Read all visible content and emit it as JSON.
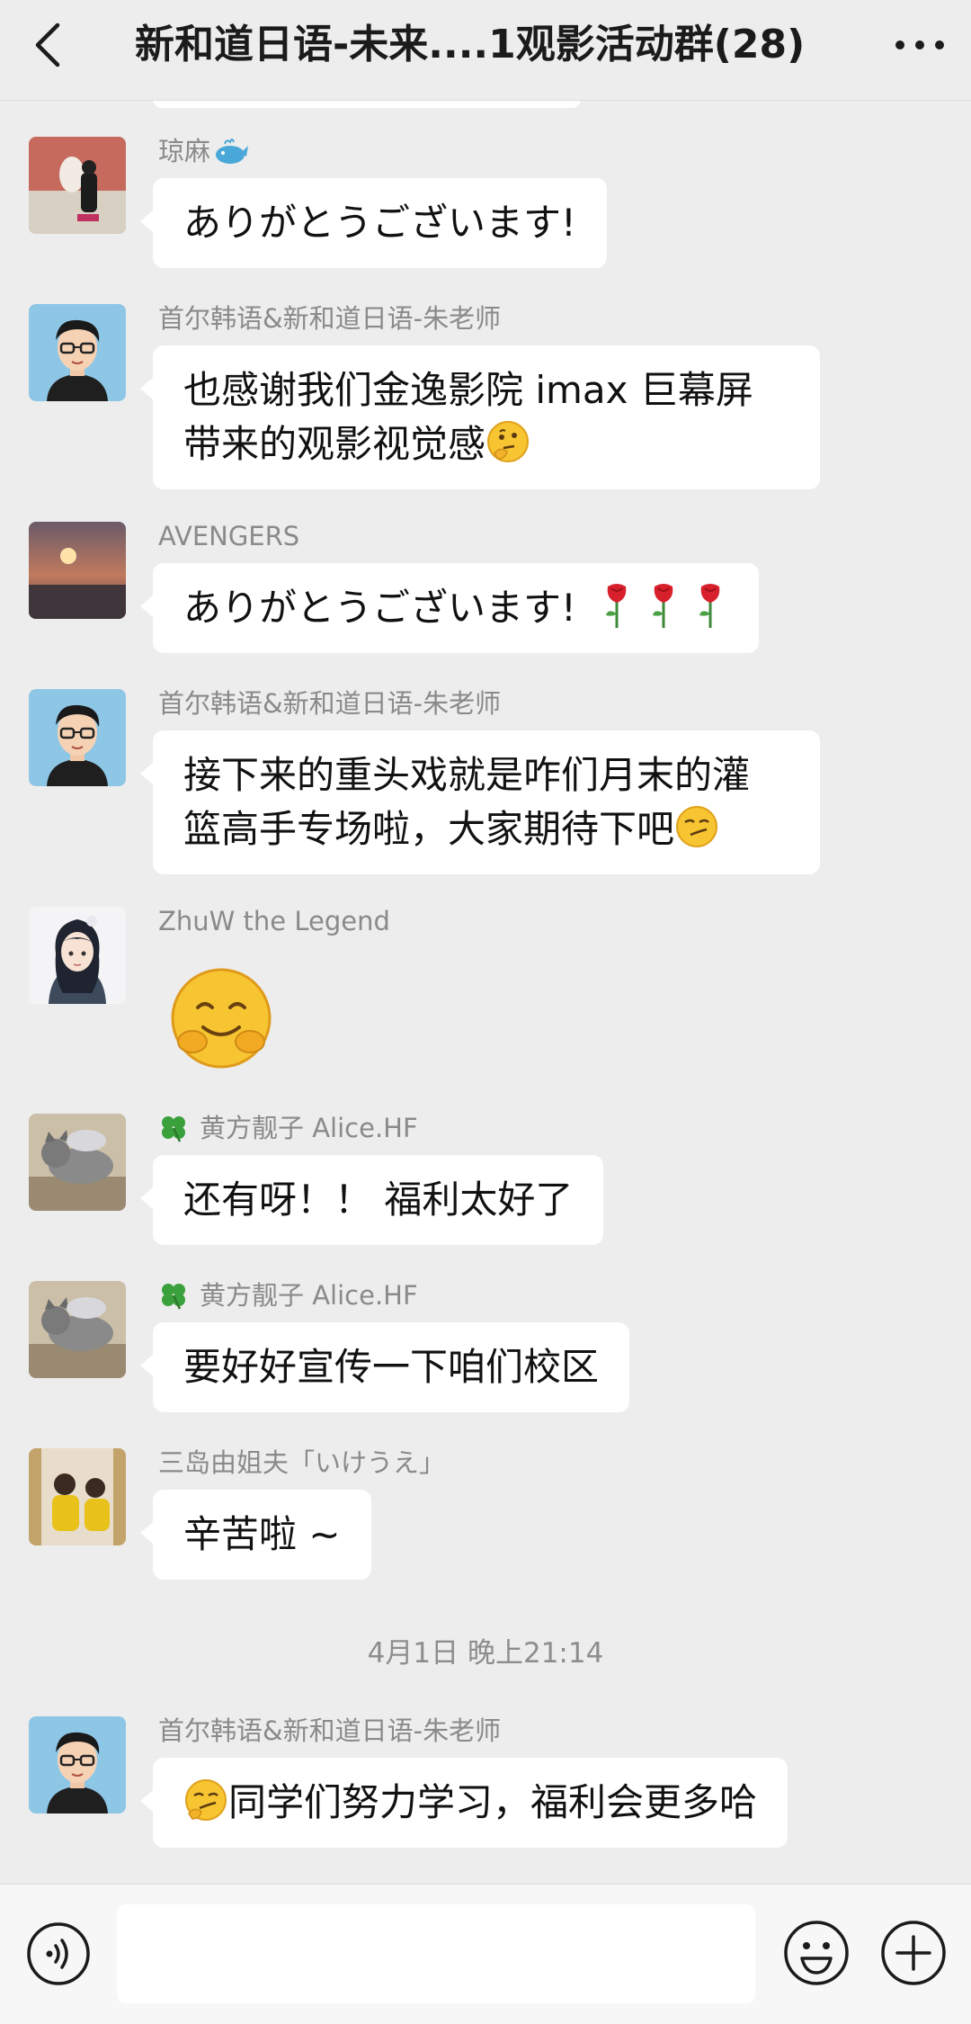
{
  "header": {
    "title": "新和道日语-未来....1观影活动群(28)"
  },
  "icons": {
    "back": "chevron-left-icon",
    "more": "more-dots-icon",
    "voice": "voice-icon",
    "emoji": "smile-icon",
    "plus": "plus-icon",
    "clover": "clover-icon",
    "whale": "whale-emoji-icon",
    "thinking": "thinking-emoji-icon",
    "smirk": "smirk-emoji-icon",
    "rose": "rose-emoji-icon",
    "hug": "hug-emoji-icon"
  },
  "colors": {
    "background": "#ededed",
    "bubble": "#ffffff",
    "sender_text": "#8a8a8a",
    "timestamp_text": "#8d8d8d"
  },
  "messages": [
    {
      "sender": "琼麻",
      "text": "ありがとうございます!",
      "avatar": "photo-avatar-1"
    },
    {
      "sender": "首尔韩语&新和道日语-朱老师",
      "lines": [
        "也感谢我们金逸影院 imax 巨幕屏",
        "带来的观影视觉感"
      ],
      "avatar": "cartoon-teacher-avatar"
    },
    {
      "sender": "AVENGERS",
      "text": "ありがとうございます!",
      "avatar": "sunset-avatar"
    },
    {
      "sender": "首尔韩语&新和道日语-朱老师",
      "lines": [
        "接下来的重头戏就是咋们月末的灌",
        "篮高手专场啦，大家期待下吧"
      ],
      "avatar": "cartoon-teacher-avatar"
    },
    {
      "sender": "ZhuW the Legend",
      "sticker": "hug-emoji-sticker",
      "avatar": "anime-avatar"
    },
    {
      "sender": "黄方靓子 Alice.HF",
      "text": "还有呀！！ 福利太好了",
      "avatar": "cat-avatar"
    },
    {
      "sender": "黄方靓子 Alice.HF",
      "text": "要好好宣传一下咱们校区",
      "avatar": "cat-avatar"
    },
    {
      "sender": "三岛由姐夫「いけうえ」",
      "text": "辛苦啦 ~",
      "avatar": "photo-avatar-2"
    },
    {
      "sender": "首尔韩语&新和道日语-朱老师",
      "text": "同学们努力学习，福利会更多哈",
      "avatar": "cartoon-teacher-avatar"
    }
  ],
  "timestamp": "4月1日 晚上21:14",
  "input": {
    "value": "",
    "placeholder": ""
  }
}
